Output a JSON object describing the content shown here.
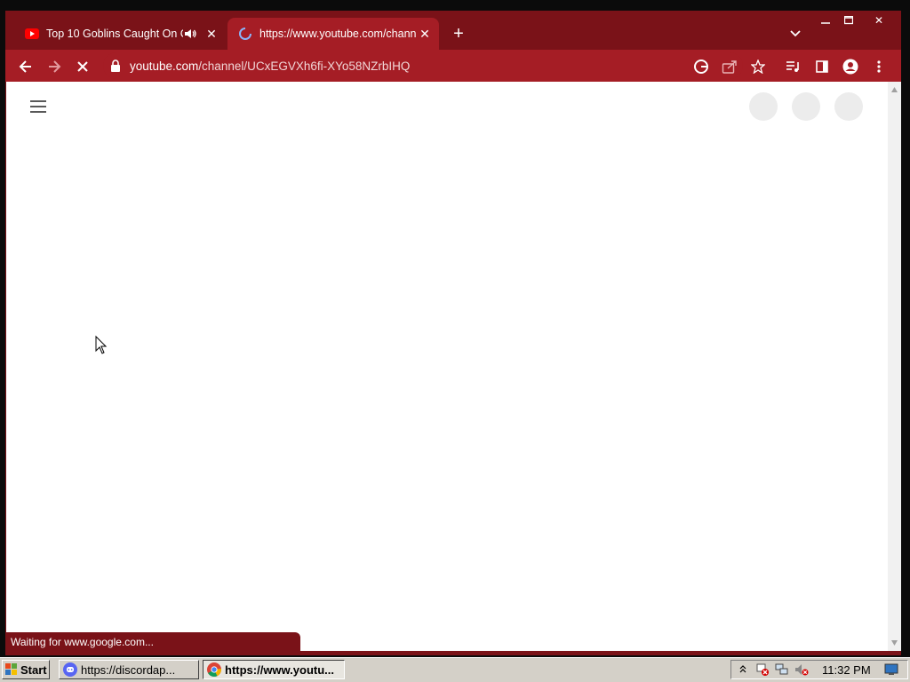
{
  "browser": {
    "tabs": [
      {
        "title": "Top 10 Goblins Caught On C",
        "favicon": "youtube-icon",
        "audio": true,
        "active": false
      },
      {
        "title": "https://www.youtube.com/channel/UCxEGVXh6fi-XYo58NZrbIHQ",
        "favicon": "loading-spinner-icon",
        "audio": false,
        "active": true
      }
    ],
    "new_tab_label": "+",
    "address": {
      "host": "youtube.com",
      "path": "/channel/UCxEGVXh6fi-XYo58NZrbIHQ"
    },
    "status_text": "Waiting for www.google.com..."
  },
  "taskbar": {
    "start_label": "Start",
    "tasks": [
      {
        "label": "https://discordap...",
        "icon": "discord-icon"
      },
      {
        "label": "https://www.youtu...",
        "icon": "chrome-icon"
      }
    ],
    "clock": "11:32 PM"
  },
  "colors": {
    "frame": "#7a1218",
    "active_tab": "#a51d25",
    "taskbar": "#d4d0c8"
  }
}
